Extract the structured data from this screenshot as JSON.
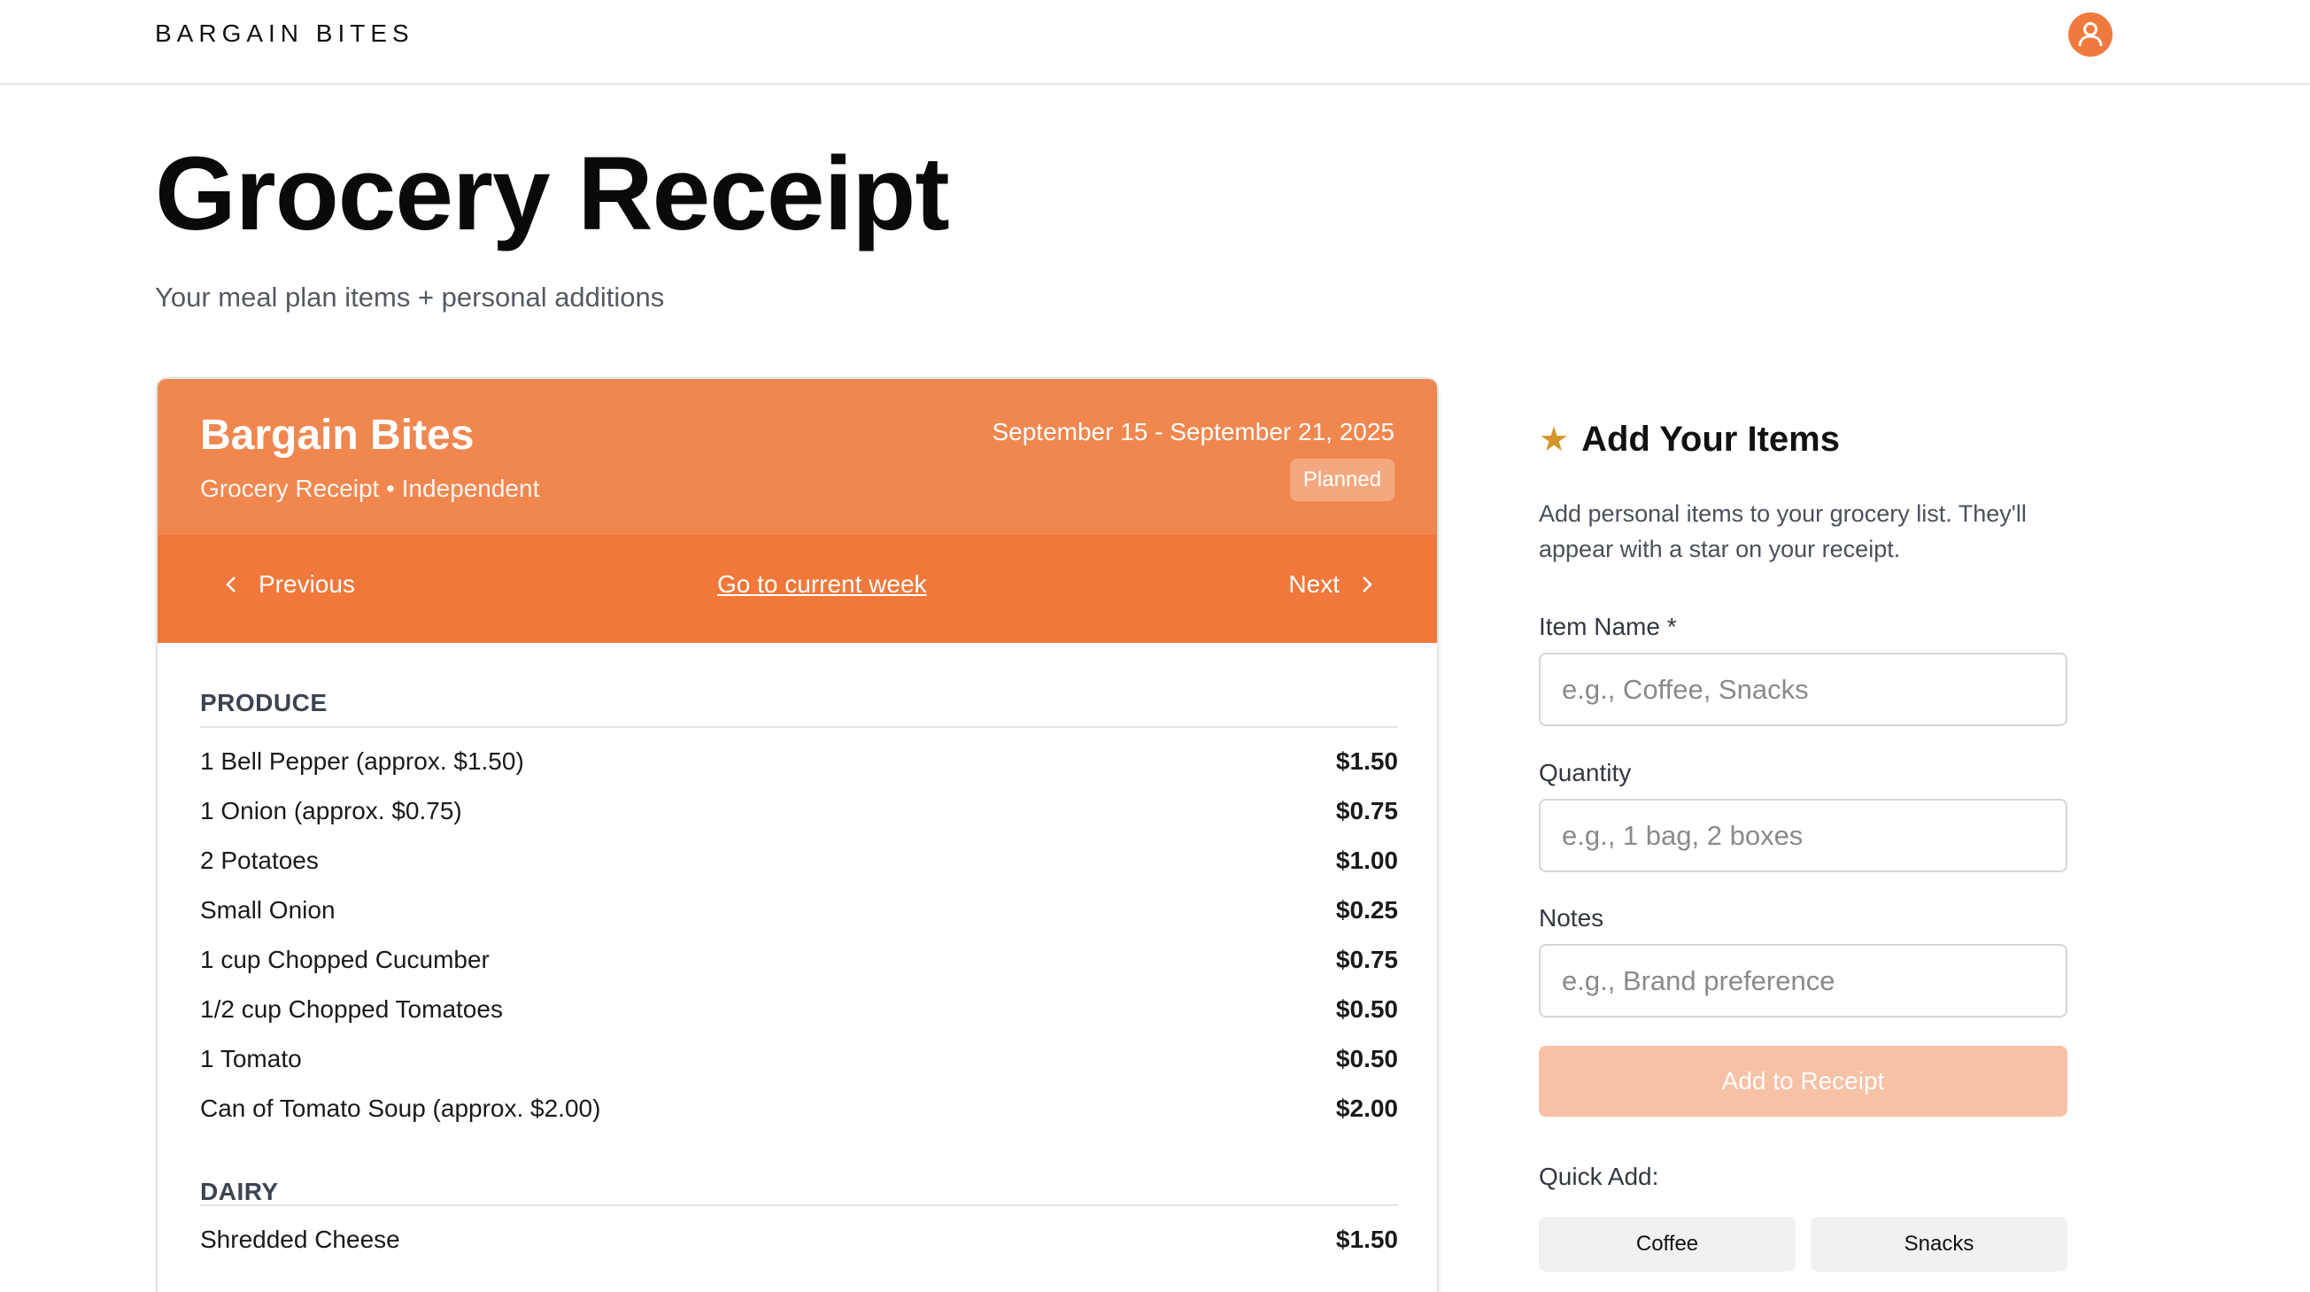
{
  "header": {
    "brand": "BARGAIN BITES",
    "avatar_icon": "user-icon"
  },
  "page": {
    "title": "Grocery Receipt",
    "subtitle": "Your meal plan items + personal additions"
  },
  "receipt": {
    "store_name": "Bargain Bites",
    "store_sub": "Grocery Receipt • Independent",
    "date_range": "September 15 - September 21, 2025",
    "status": "Planned",
    "nav": {
      "previous": "Previous",
      "current": "Go to current week",
      "next": "Next"
    },
    "sections": [
      {
        "name": "PRODUCE",
        "items": [
          {
            "name": "1 Bell Pepper (approx. $1.50)",
            "price": "$1.50"
          },
          {
            "name": "1 Onion (approx. $0.75)",
            "price": "$0.75"
          },
          {
            "name": "2 Potatoes",
            "price": "$1.00"
          },
          {
            "name": "Small Onion",
            "price": "$0.25"
          },
          {
            "name": "1 cup Chopped Cucumber",
            "price": "$0.75"
          },
          {
            "name": "1/2 cup Chopped Tomatoes",
            "price": "$0.50"
          },
          {
            "name": "1 Tomato",
            "price": "$0.50"
          },
          {
            "name": "Can of Tomato Soup (approx. $2.00)",
            "price": "$2.00"
          }
        ]
      },
      {
        "name": "DAIRY",
        "items": [
          {
            "name": "Shredded Cheese",
            "price": "$1.50"
          }
        ]
      }
    ]
  },
  "side": {
    "star_icon": "star-icon",
    "title": "Add Your Items",
    "description": "Add personal items to your grocery list. They'll appear with a star on your receipt.",
    "fields": {
      "item_name_label": "Item Name *",
      "item_name_placeholder": "e.g., Coffee, Snacks",
      "quantity_label": "Quantity",
      "quantity_placeholder": "e.g., 1 bag, 2 boxes",
      "notes_label": "Notes",
      "notes_placeholder": "e.g., Brand preference"
    },
    "add_button": "Add to Receipt",
    "quick_add_label": "Quick Add:",
    "quick_add": [
      "Coffee",
      "Snacks"
    ]
  },
  "colors": {
    "accent": "#f0783a",
    "accent_light": "#f0874f",
    "button_disabled": "#f7c1a5",
    "star": "#d4952a"
  }
}
